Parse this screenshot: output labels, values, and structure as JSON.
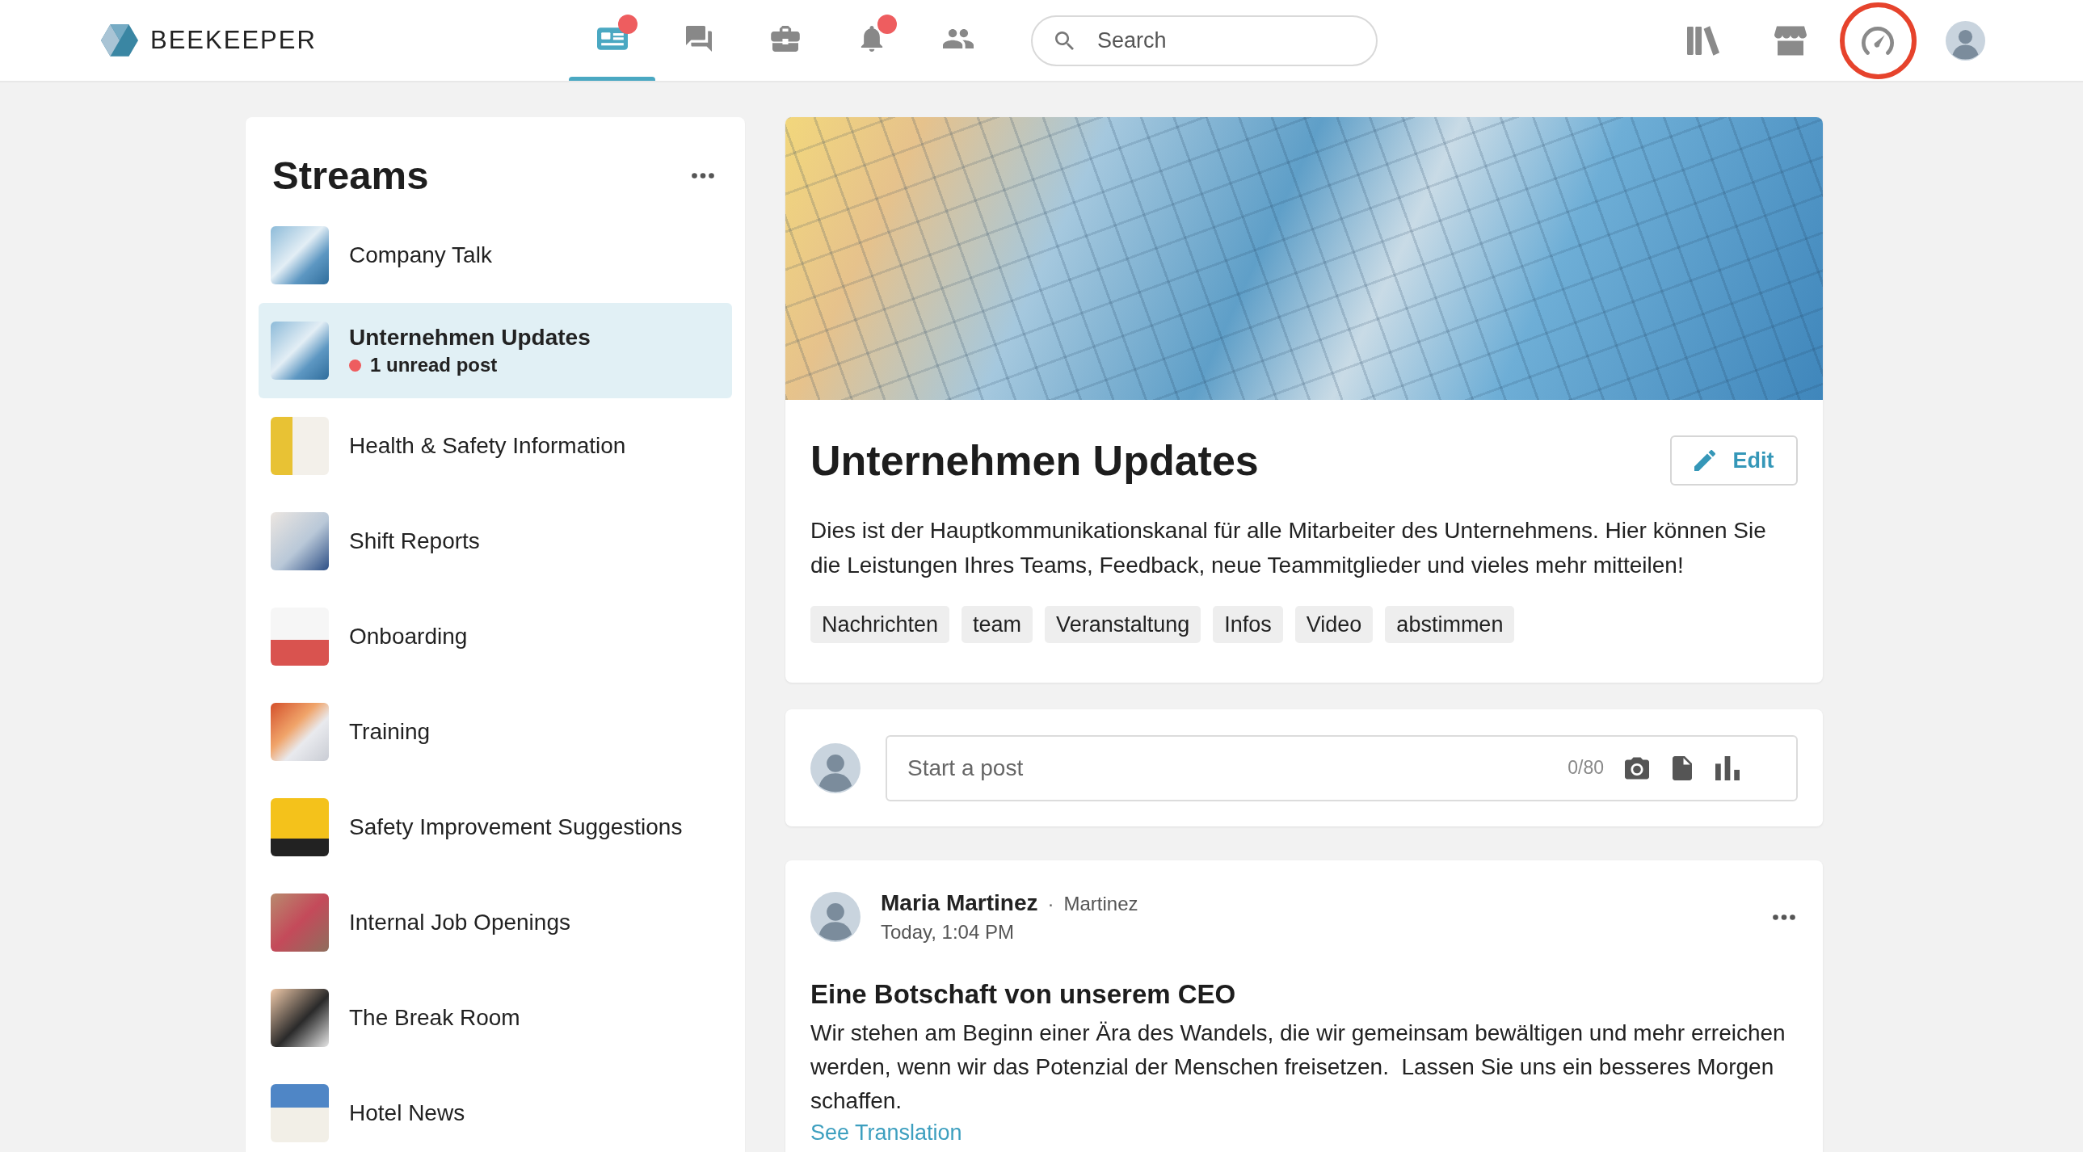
{
  "top_bar": {
    "logo": "BEEKEEPER",
    "nav": [
      {
        "kind": "feed",
        "selected": true,
        "badge": true
      },
      {
        "kind": "chat",
        "selected": false,
        "badge": false
      },
      {
        "kind": "toolbox",
        "selected": false,
        "badge": false
      },
      {
        "kind": "notifications",
        "selected": false,
        "badge": true
      },
      {
        "kind": "people",
        "selected": false,
        "badge": false
      }
    ],
    "search": {
      "placeholder": "Search"
    },
    "tools": [
      {
        "kind": "library",
        "highlighted": false
      },
      {
        "kind": "store",
        "highlighted": false
      },
      {
        "kind": "dashboard",
        "highlighted": true
      }
    ]
  },
  "sidebar": {
    "title": "Streams",
    "items": [
      {
        "name": "Company Talk",
        "selected": false
      },
      {
        "name": "Unternehmen Updates",
        "selected": true,
        "note": "1 unread post"
      },
      {
        "name": "Health & Safety Information",
        "selected": false
      },
      {
        "name": "Shift Reports",
        "selected": false
      },
      {
        "name": "Onboarding",
        "selected": false
      },
      {
        "name": "Training",
        "selected": false
      },
      {
        "name": "Safety Improvement Suggestions",
        "selected": false
      },
      {
        "name": "Internal Job Openings",
        "selected": false
      },
      {
        "name": "The Break Room",
        "selected": false
      },
      {
        "name": "Hotel News",
        "selected": false
      }
    ]
  },
  "stream": {
    "title": "Unternehmen Updates",
    "edit_button": "Edit",
    "description": "Dies ist der Hauptkommunikationskanal für alle Mitarbeiter des Unternehmens. Hier können Sie die Leistungen Ihres Teams, Feedback, neue Teammitglieder und vieles mehr mitteilen!",
    "tags": [
      "Nachrichten",
      "team",
      "Veranstaltung",
      "Infos",
      "Video",
      "abstimmen"
    ]
  },
  "composer": {
    "placeholder": "Start a post",
    "counter": "0/80"
  },
  "post": {
    "author": "Maria Martinez",
    "separator": "·",
    "username": "Martinez",
    "time": "Today, 1:04 PM",
    "title": "Eine Botschaft von unserem CEO",
    "body": "Wir stehen am Beginn einer Ära des Wandels, die wir gemeinsam bewältigen und mehr erreichen werden, wenn wir das Potenzial der Menschen freisetzen.  Lassen Sie uns ein besseres Morgen schaffen.",
    "link": "See Translation"
  }
}
